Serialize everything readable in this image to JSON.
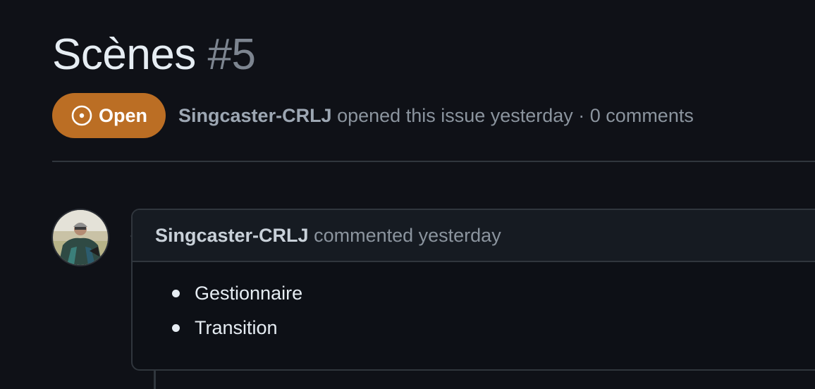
{
  "issue": {
    "title": "Scènes",
    "number": "#5",
    "state_label": "Open",
    "state_color": "#bb6e24",
    "author": "Singcaster-CRLJ",
    "meta_suffix": "opened this issue yesterday · 0 comments"
  },
  "comment": {
    "author": "Singcaster-CRLJ",
    "action": "commented yesterday",
    "avatar_icon": "user-avatar",
    "items": [
      {
        "text": "Gestionnaire"
      },
      {
        "text": "Transition"
      }
    ]
  },
  "colors": {
    "background": "#0f1117",
    "border": "#30363d",
    "muted_text": "#8b949e",
    "primary_text": "#e6edf3"
  }
}
